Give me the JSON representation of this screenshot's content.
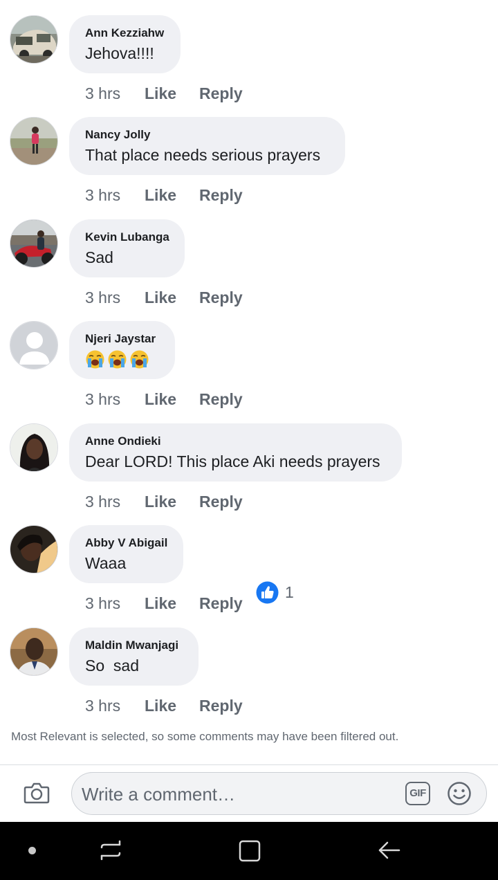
{
  "comments": [
    {
      "author": "Ann Kezziahw",
      "text": "Jehova!!!!",
      "time": "3 hrs",
      "like": "Like",
      "reply": "Reply"
    },
    {
      "author": "Nancy Jolly",
      "text": "That place needs serious prayers",
      "time": "3 hrs",
      "like": "Like",
      "reply": "Reply"
    },
    {
      "author": "Kevin Lubanga",
      "text": "Sad",
      "time": "3 hrs",
      "like": "Like",
      "reply": "Reply"
    },
    {
      "author": "Njeri Jaystar",
      "text": "",
      "emoji": [
        "loudly-crying-face-icon",
        "loudly-crying-face-icon",
        "loudly-crying-face-icon"
      ],
      "time": "3 hrs",
      "like": "Like",
      "reply": "Reply"
    },
    {
      "author": "Anne Ondieki",
      "text": "Dear LORD! This place Aki needs prayers",
      "time": "3 hrs",
      "like": "Like",
      "reply": "Reply"
    },
    {
      "author": "Abby V Abigail",
      "text": "Waaa",
      "time": "3 hrs",
      "like": "Like",
      "reply": "Reply",
      "reaction": {
        "icon": "thumbs-up-icon",
        "count": "1"
      }
    },
    {
      "author": "Maldin Mwanjagi",
      "text": "So  sad",
      "time": "3 hrs",
      "like": "Like",
      "reply": "Reply"
    }
  ],
  "filter_note": "Most Relevant is selected, so some comments may have been filtered out.",
  "composer": {
    "placeholder": "Write a comment…",
    "gif_label": "GIF",
    "camera_icon": "camera-icon",
    "emoji_icon": "smiley-icon"
  },
  "navbar": {
    "icons": [
      "menu-dot-icon",
      "recent-apps-icon",
      "home-icon",
      "back-icon"
    ]
  },
  "colors": {
    "bubble": "#eff0f4",
    "meta_text": "#606770",
    "like_blue": "#1877f2",
    "navbar": "#000000"
  }
}
